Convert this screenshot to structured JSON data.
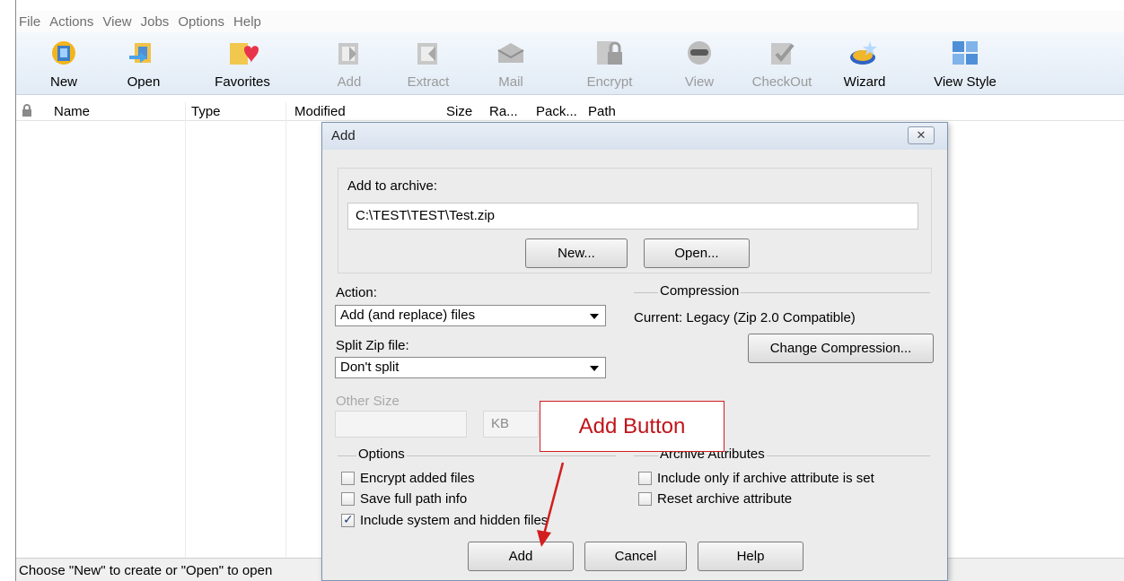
{
  "menu": [
    "File",
    "Actions",
    "View",
    "Jobs",
    "Options",
    "Help"
  ],
  "toolbar": [
    {
      "label": "New",
      "icon": "new-icon",
      "enabled": true
    },
    {
      "label": "Open",
      "icon": "open-icon",
      "enabled": true
    },
    {
      "label": "Favorites",
      "icon": "favorites-icon",
      "enabled": true
    },
    {
      "label": "Add",
      "icon": "add-icon",
      "enabled": false
    },
    {
      "label": "Extract",
      "icon": "extract-icon",
      "enabled": false
    },
    {
      "label": "Mail",
      "icon": "mail-icon",
      "enabled": false
    },
    {
      "label": "Encrypt",
      "icon": "encrypt-icon",
      "enabled": false
    },
    {
      "label": "View",
      "icon": "view-icon",
      "enabled": false
    },
    {
      "label": "CheckOut",
      "icon": "checkout-icon",
      "enabled": false
    },
    {
      "label": "Wizard",
      "icon": "wizard-icon",
      "enabled": true
    },
    {
      "label": "View Style",
      "icon": "view-style-icon",
      "enabled": true
    }
  ],
  "columns": [
    "Name",
    "Type",
    "Modified",
    "Size",
    "Ra...",
    "Pack...",
    "Path"
  ],
  "status": "Choose \"New\" to create or \"Open\" to open",
  "dialog": {
    "title": "Add",
    "close_glyph": "✕",
    "add_to_archive_label": "Add to archive:",
    "archive_path": "C:\\TEST\\TEST\\Test.zip",
    "new_button": "New...",
    "open_button": "Open...",
    "action_label": "Action:",
    "action_value": "Add (and replace) files",
    "split_label": "Split Zip file:",
    "split_value": "Don't split",
    "other_size_label": "Other Size",
    "other_size_unit": "KB",
    "compression_header": "Compression",
    "compression_current": "Current: Legacy (Zip 2.0 Compatible)",
    "change_compression_button": "Change Compression...",
    "options_header": "Options",
    "options": [
      {
        "label": "Encrypt added files",
        "checked": false
      },
      {
        "label": "Save full path info",
        "checked": false
      },
      {
        "label": "Include system and hidden files",
        "checked": true
      }
    ],
    "archive_attributes_header": "Archive Attributes",
    "archive_attributes": [
      {
        "label": "Include only if archive attribute is set",
        "checked": false
      },
      {
        "label": "Reset archive attribute",
        "checked": false
      }
    ],
    "add_button": "Add",
    "cancel_button": "Cancel",
    "help_button": "Help"
  },
  "annotation": {
    "callout_text": "Add Button",
    "color": "#d21e1e"
  }
}
